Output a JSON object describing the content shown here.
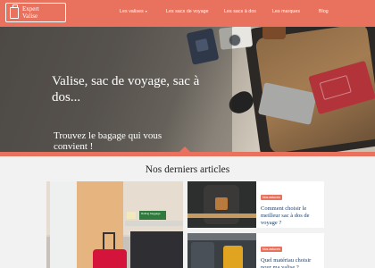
{
  "brand": {
    "line1": "Expert",
    "line2": "Valise"
  },
  "nav": {
    "items": [
      {
        "label": "Les valises",
        "has_dropdown": true
      },
      {
        "label": "Les sacs de voyage",
        "has_dropdown": false
      },
      {
        "label": "Les sacs à dos",
        "has_dropdown": false
      },
      {
        "label": "Les marques",
        "has_dropdown": false
      },
      {
        "label": "Blog",
        "has_dropdown": false
      }
    ],
    "caret": "▾"
  },
  "hero": {
    "title": "Valise, sac de voyage, sac à dos...",
    "subtitle": "Trouvez le bagage qui vous convient !"
  },
  "articles": {
    "section_title": "Nos derniers articles",
    "featured_sign_text": "Rolling baggage",
    "items": [
      {
        "tag": "Nos astuces",
        "title": "Comment choisir le meilleur sac à dos de voyage ?"
      },
      {
        "tag": "Nos astuces",
        "title": "Quel matériau choisir pour ma valise ?"
      }
    ]
  },
  "colors": {
    "accent": "#e9725f",
    "title_link": "#1f3e66",
    "background": "#f2f2f2"
  },
  "icons": [
    "suitcase-icon",
    "chevron-down-icon"
  ]
}
